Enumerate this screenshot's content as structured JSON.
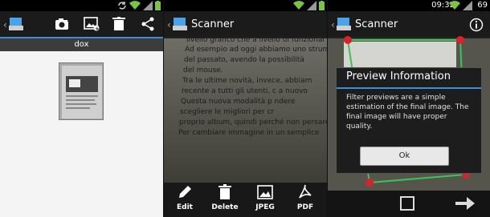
{
  "panel1": {
    "toolbar_actions": [
      "camera-add-icon",
      "image-add-icon",
      "trash-icon",
      "share-icon"
    ],
    "folder": {
      "name": "dox"
    }
  },
  "panel2": {
    "app_title": "Scanner",
    "photo_text": [
      "livello grafico che a livello di funzional",
      "Ad esempio ad oggi abbiamo uno strume",
      "del passato, avendo la possibilità",
      "del mouse.",
      "Tra le ultime novità, invece, abbiam",
      "recente a tutti gli utenti, c a nuovo",
      "Questa nuova modalità p ndere",
      "scegliere le migliori per cr",
      "proprio album, quindi perché non persare",
      "Per cambiare immagine in un semplice"
    ],
    "toolbar": {
      "edit": "Edit",
      "delete": "Delete",
      "jpeg": "JPEG",
      "pdf": "PDF"
    }
  },
  "panel3": {
    "status_time": "09:32",
    "status_battery": "69",
    "app_title": "Scanner",
    "dialog": {
      "title": "Preview Information",
      "body": "Filter previews are a simple estimation of the final image. The final image will have proper quality.",
      "ok_label": "Ok"
    }
  },
  "colors": {
    "accent_blue": "#3b8fd6",
    "handle_red": "#d8232a",
    "status_green": "#7cc544"
  }
}
